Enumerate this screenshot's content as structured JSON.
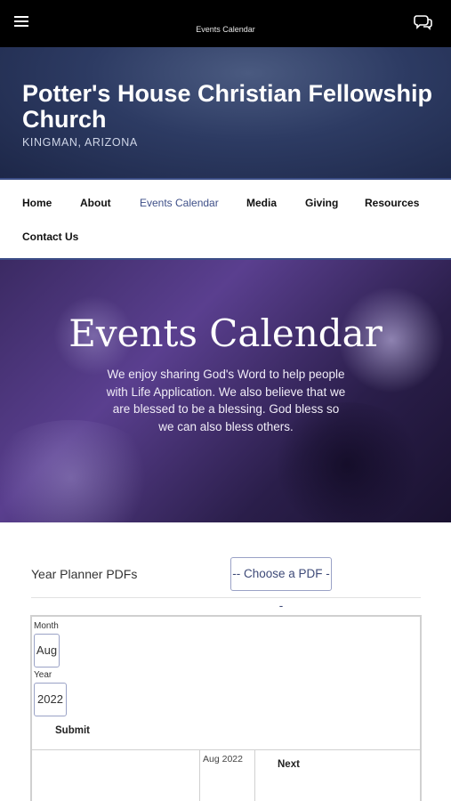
{
  "topbar": {
    "title": "Events Calendar",
    "menu_icon": "hamburger-menu-icon",
    "chat_icon": "chat-bubbles-icon"
  },
  "header": {
    "site_title": "Potter's House Christian Fellowship Church",
    "location": "KINGMAN,  ARIZONA"
  },
  "nav": {
    "items": [
      {
        "label": "Home"
      },
      {
        "label": "About"
      },
      {
        "label": "Events Calendar"
      },
      {
        "label": "Media"
      },
      {
        "label": "Giving"
      },
      {
        "label": "Resources"
      },
      {
        "label": "Contact Us"
      }
    ],
    "active": "Events Calendar"
  },
  "hero": {
    "title": "Events Calendar",
    "text": "We enjoy sharing God's Word to help people with Life Application.  We also believe that we are blessed to be a blessing. God bless so we can also bless others."
  },
  "planner": {
    "label": "Year Planner PDFs",
    "select_value": "-- Choose a PDF --"
  },
  "calendar_form": {
    "month_label": "Month",
    "month_value": "Aug",
    "year_label": "Year",
    "year_value": "2022",
    "submit_label": "Submit"
  },
  "calendar_nav": {
    "current": "Aug 2022",
    "next_label": "Next"
  },
  "colors": {
    "accent": "#3e4f88",
    "topbar": "#000000",
    "header_bg": "#2d3b63",
    "hero_bg": "#4a3580"
  }
}
